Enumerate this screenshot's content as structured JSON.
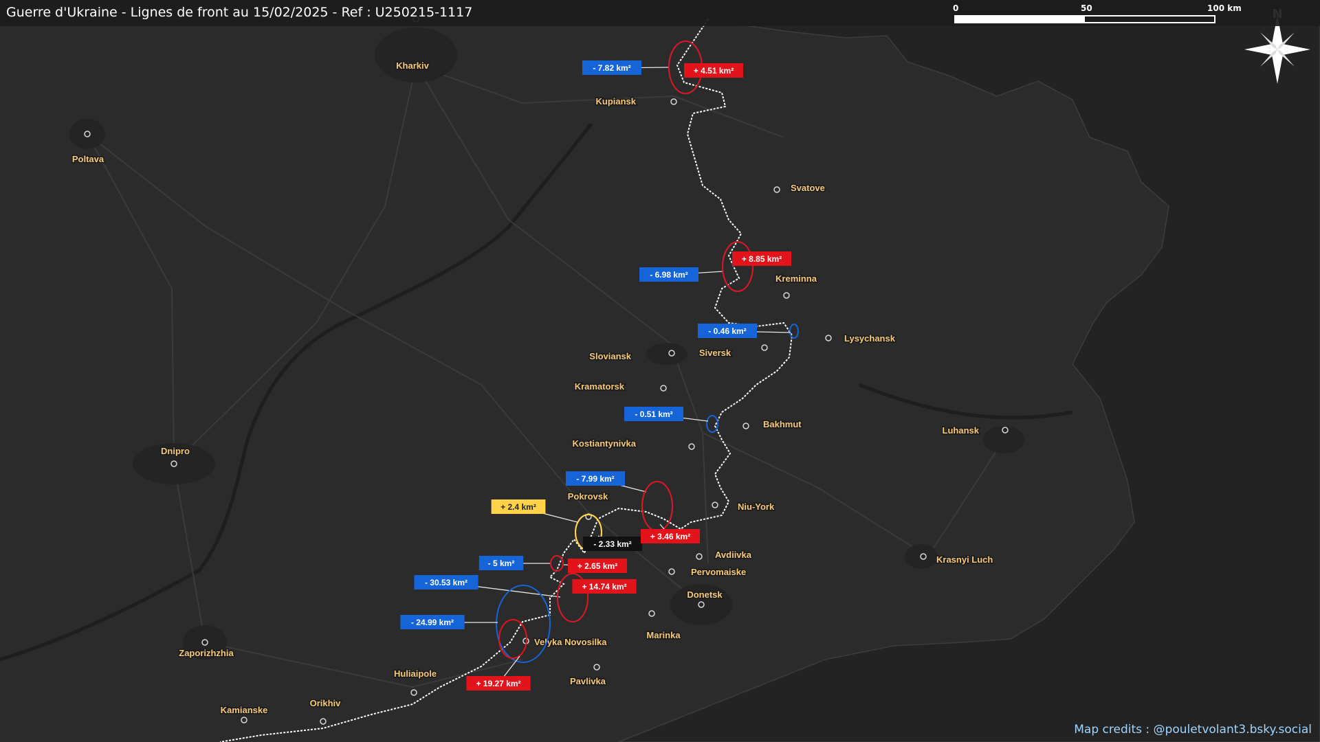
{
  "title": "Guerre d'Ukraine - Lignes de front au 15/02/2025 - Ref : U250215-1117",
  "credits": "Map credits : @pouletvolant3.bsky.social",
  "scale": {
    "labels": [
      "0",
      "50",
      "100 km"
    ]
  },
  "north_label": "N",
  "colors": {
    "background": "#2b2b2b",
    "occupied": "#222222",
    "city_label": "#f6c97a",
    "gain": "#e3131b",
    "loss": "#1565d8",
    "neutral": "#ffd24a",
    "front_line": "#ffffff"
  },
  "cities": [
    {
      "name": "Kharkiv",
      "icon": "city-marker-icon"
    },
    {
      "name": "Poltava",
      "icon": "city-marker-icon"
    },
    {
      "name": "Kupiansk",
      "icon": "city-marker-icon"
    },
    {
      "name": "Svatove",
      "icon": "city-marker-icon"
    },
    {
      "name": "Kreminna",
      "icon": "city-marker-icon"
    },
    {
      "name": "Lysychansk",
      "icon": "city-marker-icon"
    },
    {
      "name": "Siversk",
      "icon": "city-marker-icon"
    },
    {
      "name": "Sloviansk",
      "icon": "city-marker-icon"
    },
    {
      "name": "Kramatorsk",
      "icon": "city-marker-icon"
    },
    {
      "name": "Bakhmut",
      "icon": "city-marker-icon"
    },
    {
      "name": "Luhansk",
      "icon": "city-marker-icon"
    },
    {
      "name": "Kostiantynivka",
      "icon": "city-marker-icon"
    },
    {
      "name": "Dnipro",
      "icon": "city-marker-icon"
    },
    {
      "name": "Pokrovsk",
      "icon": "city-marker-icon"
    },
    {
      "name": "Niu-York",
      "icon": "city-marker-icon"
    },
    {
      "name": "Avdiivka",
      "icon": "city-marker-icon"
    },
    {
      "name": "Pervomaiske",
      "icon": "city-marker-icon"
    },
    {
      "name": "Krasnyi Luch",
      "icon": "city-marker-icon"
    },
    {
      "name": "Donetsk",
      "icon": "city-marker-icon"
    },
    {
      "name": "Marinka",
      "icon": "city-marker-icon"
    },
    {
      "name": "Velyka Novosilka",
      "icon": "city-marker-icon"
    },
    {
      "name": "Zaporizhzhia",
      "icon": "city-marker-icon"
    },
    {
      "name": "Huliaipole",
      "icon": "city-marker-icon"
    },
    {
      "name": "Pavlivka",
      "icon": "city-marker-icon"
    },
    {
      "name": "Orikhiv",
      "icon": "city-marker-icon"
    },
    {
      "name": "Kamianske",
      "icon": "city-marker-icon"
    }
  ],
  "changes": [
    {
      "text": "- 7.82 km²",
      "type": "loss"
    },
    {
      "text": "+ 4.51 km²",
      "type": "gain"
    },
    {
      "text": "- 6.98 km²",
      "type": "loss"
    },
    {
      "text": "+ 8.85 km²",
      "type": "gain"
    },
    {
      "text": "- 0.46 km²",
      "type": "loss"
    },
    {
      "text": "- 0.51 km²",
      "type": "loss"
    },
    {
      "text": "- 7.99 km²",
      "type": "loss"
    },
    {
      "text": "+ 2.4 km²",
      "type": "neutral"
    },
    {
      "text": "- 2.33 km²",
      "type": "black"
    },
    {
      "text": "+ 3.46 km²",
      "type": "gain"
    },
    {
      "text": "- 5 km²",
      "type": "loss"
    },
    {
      "text": "+ 2.65 km²",
      "type": "gain"
    },
    {
      "text": "- 30.53 km²",
      "type": "loss"
    },
    {
      "text": "+ 14.74 km²",
      "type": "gain"
    },
    {
      "text": "- 24.99 km²",
      "type": "loss"
    },
    {
      "text": "+ 19.27 km²",
      "type": "gain"
    }
  ]
}
